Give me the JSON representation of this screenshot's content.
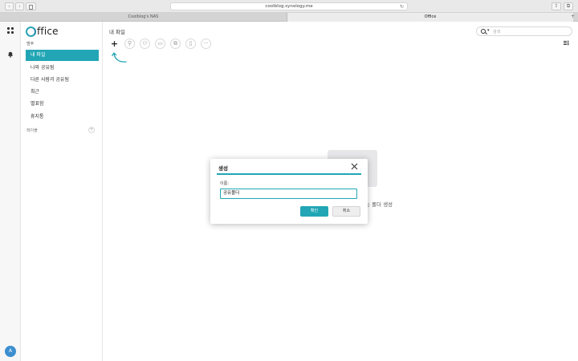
{
  "browser": {
    "url": "coolblog.synology.me",
    "tabs": [
      {
        "label": "Coolblog's NAS"
      },
      {
        "label": "Office"
      }
    ],
    "new_tab": "+"
  },
  "rail": {
    "avatar_initial": "A"
  },
  "sidebar": {
    "logo": "ffice",
    "section_label": "범주",
    "items": [
      {
        "label": "내 파일",
        "active": true
      },
      {
        "label": "나와 공유됨"
      },
      {
        "label": "다른 사람과 공유됨"
      },
      {
        "label": "최근"
      },
      {
        "label": "별표함"
      },
      {
        "label": "휴지통"
      }
    ],
    "labels_section": "레이블",
    "labels_add": "+"
  },
  "main": {
    "breadcrumb": "내 파일",
    "search_placeholder": "검색",
    "toolbar": {
      "new_label": "+",
      "more_label": "···"
    },
    "empty_text": "는 폴더 생성"
  },
  "dialog": {
    "title": "생성",
    "name_label": "이름:",
    "name_value": "공유폴더",
    "ok_label": "확인",
    "cancel_label": "취소"
  },
  "colors": {
    "accent": "#22a6b5",
    "avatar": "#3c8fd0"
  }
}
